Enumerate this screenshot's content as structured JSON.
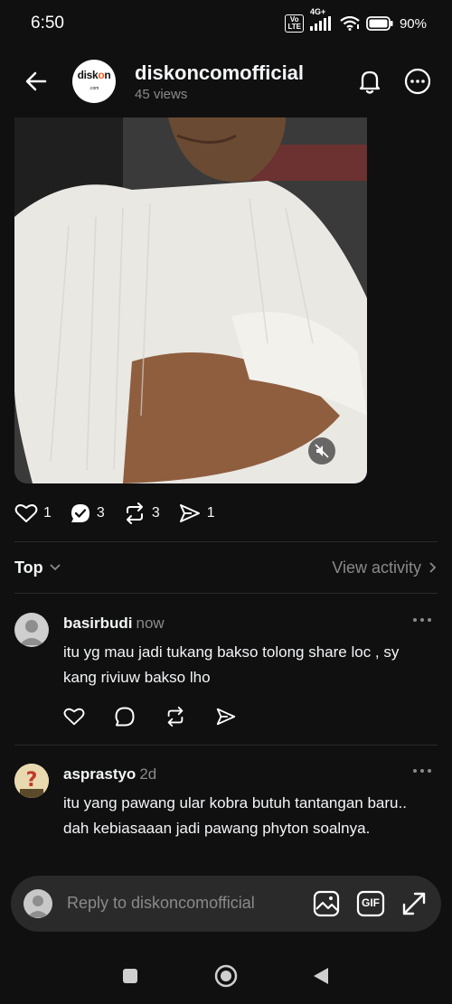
{
  "status": {
    "time": "6:50",
    "volte": "Vo LTE",
    "network": "4G+",
    "battery": "90%"
  },
  "header": {
    "logo_text_1": "disk",
    "logo_text_2": "o",
    "logo_text_3": "n",
    "logo_sub": ".com",
    "account": "diskoncomofficial",
    "views": "45 views"
  },
  "post_actions": {
    "likes": "1",
    "replies": "3",
    "reposts": "3",
    "shares": "1"
  },
  "sort": {
    "label": "Top",
    "view_activity": "View activity"
  },
  "comments": [
    {
      "user": "basirbudi",
      "time": "now",
      "text": "itu yg mau jadi tukang bakso tolong share loc , sy kang riviuw bakso lho"
    },
    {
      "user": "asprastyo",
      "time": "2d",
      "text": "itu yang pawang ular kobra butuh tantangan baru.. dah kebiasaaan jadi pawang phyton soalnya."
    }
  ],
  "reply": {
    "placeholder": "Reply to diskoncomofficial",
    "gif_label": "GIF"
  },
  "colors": {
    "background": "#101010",
    "text": "#f3f5f7",
    "muted": "#8a8a8a",
    "logo_accent": "#e85d1b"
  }
}
